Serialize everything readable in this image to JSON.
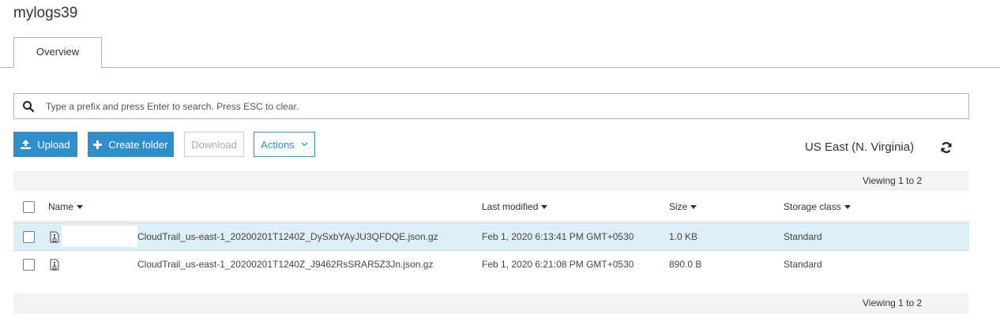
{
  "bucket": {
    "title": "mylogs39"
  },
  "tabs": [
    {
      "label": "Overview"
    }
  ],
  "search": {
    "placeholder": "Type a prefix and press Enter to search. Press ESC to clear."
  },
  "toolbar": {
    "upload_label": "Upload",
    "create_folder_label": "Create folder",
    "download_label": "Download",
    "actions_label": "Actions"
  },
  "region": {
    "label": "US East (N. Virginia)"
  },
  "pagination": {
    "top": "Viewing 1 to 2",
    "bottom": "Viewing 1 to 2"
  },
  "table": {
    "columns": {
      "name": "Name",
      "modified": "Last modified",
      "size": "Size",
      "storage_class": "Storage class"
    },
    "rows": [
      {
        "name": "CloudTrail_us-east-1_20200201T1240Z_DySxbYAyJU3QFDQE.json.gz",
        "modified": "Feb 1, 2020 6:13:41 PM GMT+0530",
        "size": "1.0 KB",
        "storage_class": "Standard",
        "selected": true
      },
      {
        "name": "CloudTrail_us-east-1_20200201T1240Z_J9462RsSRAR5Z3Jn.json.gz",
        "modified": "Feb 1, 2020 6:21:08 PM GMT+0530",
        "size": "890.0 B",
        "storage_class": "Standard",
        "selected": false
      }
    ]
  },
  "colors": {
    "primary": "#2f8fcc",
    "selected_row": "#deeef7",
    "bar": "#f2f3f3"
  },
  "icons": [
    "search-icon",
    "upload-icon",
    "plus-icon",
    "chevron-down-icon",
    "refresh-icon",
    "file-icon"
  ]
}
